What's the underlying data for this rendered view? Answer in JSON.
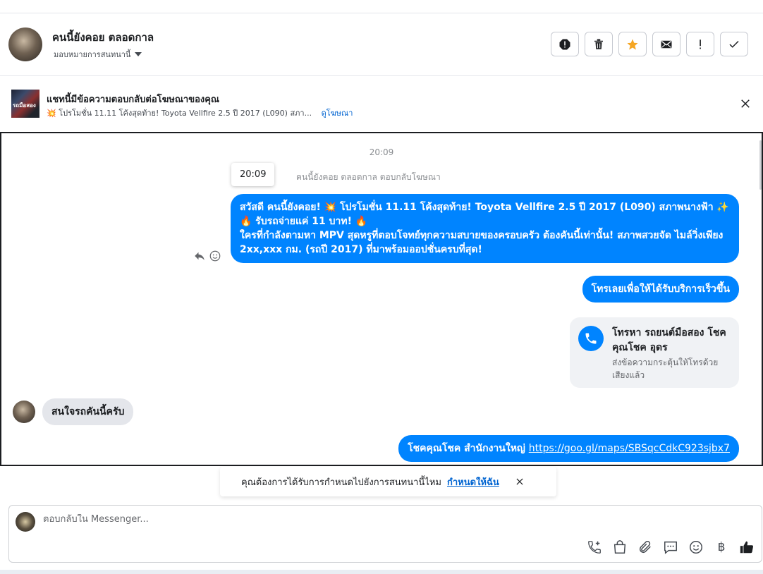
{
  "header": {
    "name": "คนนี้ยังคอย ตลอดกาล",
    "assign_label": "มอบหมายการสนทนานี้"
  },
  "actions": [
    {
      "icon": "spam-icon"
    },
    {
      "icon": "trash-icon"
    },
    {
      "icon": "star-icon",
      "color": "#f5a623"
    },
    {
      "icon": "mail-icon"
    },
    {
      "icon": "exclamation-icon"
    },
    {
      "icon": "check-icon"
    }
  ],
  "ad": {
    "thumb_text": "รถมือสอง",
    "title": "แชทนี้มีข้อความตอบกลับต่อโฆษณาของคุณ",
    "desc": "💥 โปรโมชั่น 11.11 โค้งสุดท้าย! Toyota Vellfire 2.5 ปี 2017 (L090) สภา...",
    "link": "ดูโฆษณา"
  },
  "chat": {
    "timestamp": "20:09",
    "tooltip_time": "20:09",
    "reply_meta": "คนนี้ยังคอย ตลอดกาล ตอบกลับโฆษณา",
    "messages": {
      "m1_line1": "สวัสดี คนนี้ยังคอย! 💥 โปรโมชั่น 11.11 โค้งสุดท้าย! Toyota Vellfire 2.5 ปี 2017 (L090) สภาพนางฟ้า ✨",
      "m1_line2": "🔥 รับรถจ่ายแค่ 11 บาท! 🔥",
      "m1_line3": "ใครที่กำลังตามหา MPV สุดหรูที่ตอบโจทย์ทุกความสบายของครอบครัว ต้องคันนี้เท่านั้น! สภาพสวยจัด ไมล์วิ่งเพียง 2xx,xxx กม. (รถปี 2017) ที่มาพร้อมออปชั่นครบที่สุด!",
      "m2": "โทรเลยเพื่อให้ได้รับบริการเร็วขึ้น",
      "call_title": "โทรหา รถยนต์มือสอง โชคคุณโชค อุดร",
      "call_sub": "ส่งข้อความกระตุ้นให้โทรด้วยเสียงแล้ว",
      "incoming": "สนใจรถคันนี้ครับ",
      "m4_prefix": "โชคคุณโชค สำนักงานใหญ่",
      "m4_link": "https://goo.gl/maps/SBSqcCdkC923sjbx7"
    }
  },
  "toast": {
    "text": "คุณต้องการได้รับการกำหนดไปยังการสนทนานี้ไหม",
    "link": "กำหนดให้ฉัน"
  },
  "composer": {
    "placeholder": "ตอบกลับใน Messenger...",
    "currency": "฿"
  },
  "colors": {
    "accent": "#0084ff",
    "link": "#0064d1"
  }
}
